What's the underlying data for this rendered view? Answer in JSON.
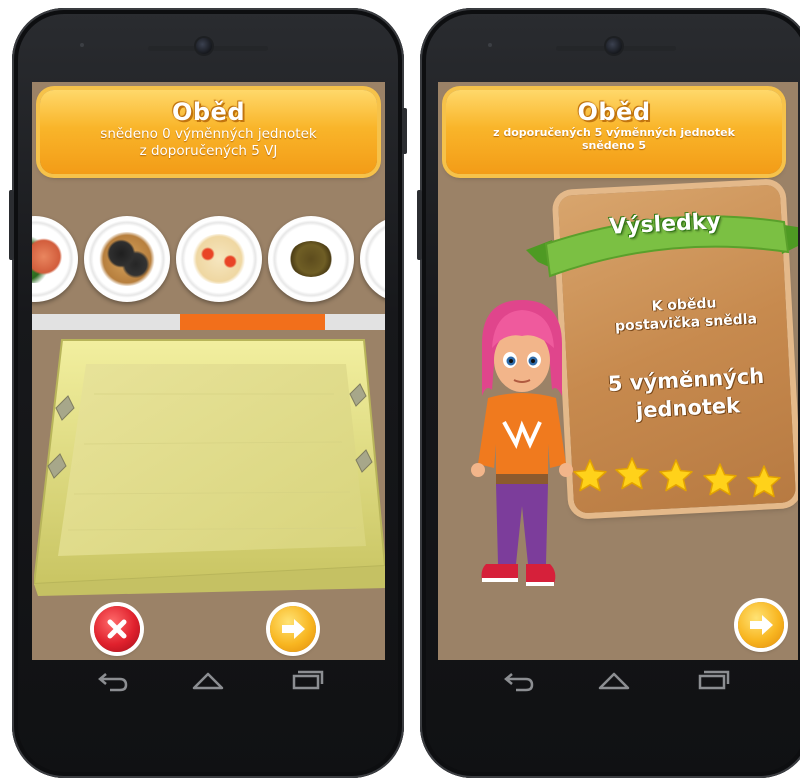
{
  "left_screen": {
    "banner": {
      "title": "Oběd",
      "line1": "snědeno 0 výměnných jednotek",
      "line2": "z doporučených 5 VJ"
    },
    "plates": [
      {
        "name": "salmon-salad",
        "colors": [
          "#e0795a",
          "#3c7b2d"
        ]
      },
      {
        "name": "mussels-pasta",
        "colors": [
          "#2a2a2a",
          "#d4a05c"
        ]
      },
      {
        "name": "tomato-gnocchi",
        "colors": [
          "#f4e2b8",
          "#e64a2a"
        ]
      },
      {
        "name": "lentil-dish",
        "colors": [
          "#5b4b1c",
          "#7b6a28"
        ]
      },
      {
        "name": "partial-plate",
        "colors": [
          "#ffffff",
          "#eeeeee"
        ]
      }
    ],
    "progress_fraction": 0.2,
    "progress_segment": 2,
    "progress_segments": 5,
    "buttons": {
      "cancel": "cancel",
      "next": "next"
    }
  },
  "right_screen": {
    "banner": {
      "title": "Oběd",
      "line1": "z doporučených 5 výměnných jednotek",
      "line2": "snědeno 5"
    },
    "results": {
      "ribbon": "Výsledky",
      "line1": "K obědu",
      "line2": "postavička snědla",
      "line3": "5 výměnných",
      "line4": "jednotek",
      "stars": 5
    },
    "buttons": {
      "next": "next"
    }
  },
  "colors": {
    "background": "#9b8267",
    "banner": "#f9b52a",
    "progress": "#f26f1b",
    "ribbon": "#7bc043",
    "board": "#c78a4e",
    "star": "#ffd21a"
  },
  "icons": [
    "back-icon",
    "home-icon",
    "recents-icon",
    "close-icon",
    "arrow-right-icon",
    "star-icon"
  ]
}
